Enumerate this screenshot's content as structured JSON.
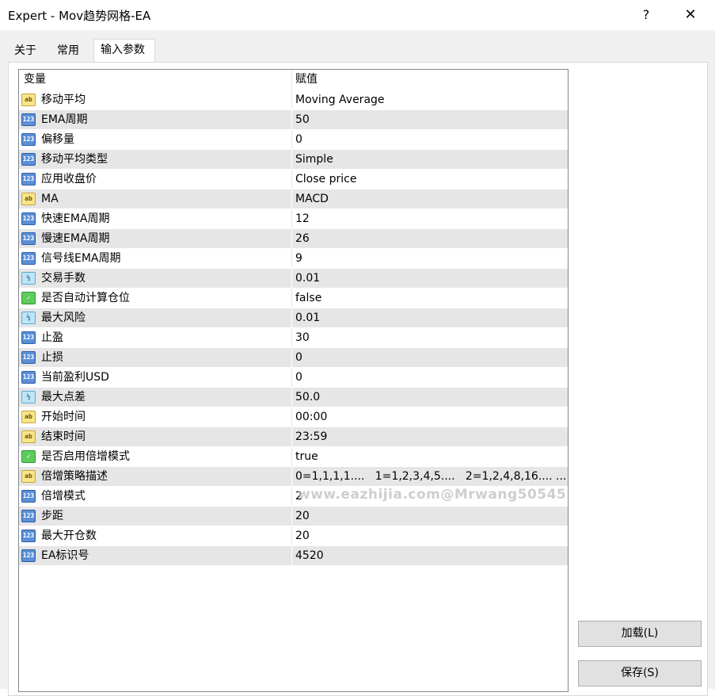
{
  "window": {
    "title": "Expert - Mov趋势网格-EA",
    "help_label": "?",
    "close_label": "✕"
  },
  "tabs": [
    {
      "label": "关于"
    },
    {
      "label": "常用"
    },
    {
      "label": "输入参数"
    }
  ],
  "grid": {
    "header": {
      "variable": "变量",
      "value": "赋值"
    },
    "rows": [
      {
        "icon": "ab",
        "name": "移动平均",
        "value": "Moving Average"
      },
      {
        "icon": "123",
        "name": "EMA周期",
        "value": "50"
      },
      {
        "icon": "123",
        "name": "偏移量",
        "value": "0"
      },
      {
        "icon": "123",
        "name": "移动平均类型",
        "value": "Simple"
      },
      {
        "icon": "123",
        "name": "应用收盘价",
        "value": "Close price"
      },
      {
        "icon": "ab",
        "name": "MA",
        "value": "MACD"
      },
      {
        "icon": "123",
        "name": "快速EMA周期",
        "value": "12"
      },
      {
        "icon": "123",
        "name": "慢速EMA周期",
        "value": "26"
      },
      {
        "icon": "123",
        "name": "信号线EMA周期",
        "value": "9"
      },
      {
        "icon": "½",
        "name": "交易手数",
        "value": "0.01"
      },
      {
        "icon": "bool",
        "name": "是否自动计算仓位",
        "value": "false"
      },
      {
        "icon": "½",
        "name": "最大风险",
        "value": "0.01"
      },
      {
        "icon": "123",
        "name": "止盈",
        "value": "30"
      },
      {
        "icon": "123",
        "name": "止损",
        "value": "0"
      },
      {
        "icon": "123",
        "name": "当前盈利USD",
        "value": "0"
      },
      {
        "icon": "½",
        "name": "最大点差",
        "value": "50.0"
      },
      {
        "icon": "ab",
        "name": "开始时间",
        "value": "00:00"
      },
      {
        "icon": "ab",
        "name": "结束时间",
        "value": "23:59"
      },
      {
        "icon": "bool",
        "name": "是否启用倍增模式",
        "value": "true"
      },
      {
        "icon": "ab",
        "name": "倍增策略描述",
        "value": "0=1,1,1,1....   1=1,2,3,4,5....   2=1,2,4,8,16.... ..."
      },
      {
        "icon": "123",
        "name": "倍增模式",
        "value": "2"
      },
      {
        "icon": "123",
        "name": "步距",
        "value": "20"
      },
      {
        "icon": "123",
        "name": "最大开仓数",
        "value": "20"
      },
      {
        "icon": "123",
        "name": "EA标识号",
        "value": "4520"
      }
    ]
  },
  "watermark": "www.eazhijia.com@Mrwang50545",
  "buttons": {
    "load": "加载(L)",
    "save": "保存(S)"
  }
}
